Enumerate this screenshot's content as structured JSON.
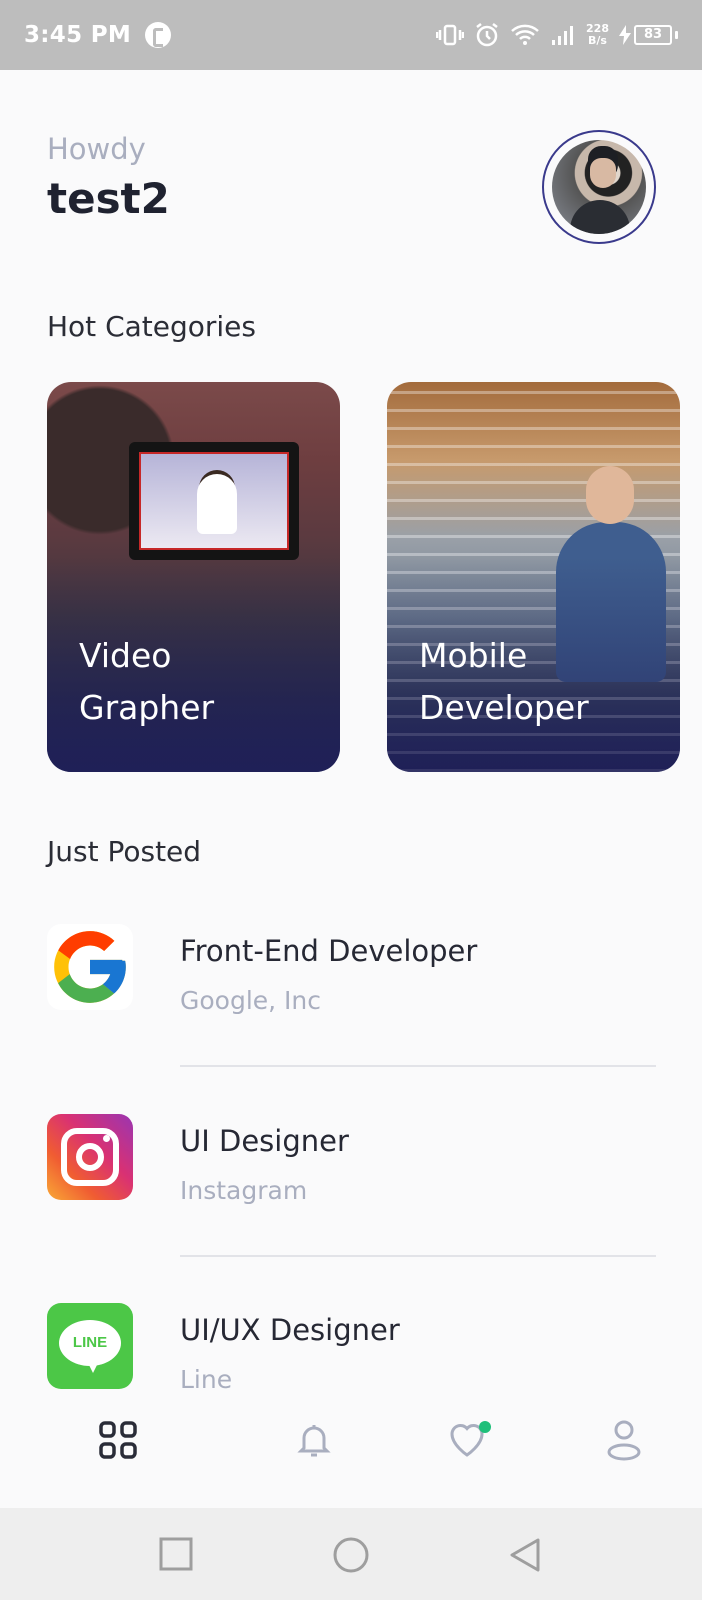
{
  "status_bar": {
    "time": "3:45 PM",
    "net_speed_value": "228",
    "net_speed_unit": "B/s",
    "battery": "83"
  },
  "header": {
    "greeting": "Howdy",
    "username": "test2"
  },
  "sections": {
    "hot_categories": "Hot Categories",
    "just_posted": "Just Posted"
  },
  "categories": [
    {
      "label": "Video\nGrapher"
    },
    {
      "label": "Mobile\nDeveloper"
    }
  ],
  "jobs": [
    {
      "title": "Front-End Developer",
      "company": "Google, Inc",
      "logo": "google-logo"
    },
    {
      "title": "UI Designer",
      "company": "Instagram",
      "logo": "instagram-logo"
    },
    {
      "title": "UI/UX Designer",
      "company": "Line",
      "logo": "line-logo"
    }
  ],
  "logo_text": {
    "line": "LINE"
  },
  "bottom_nav": [
    {
      "icon": "grid-icon",
      "active": true
    },
    {
      "icon": "bell-icon",
      "active": false
    },
    {
      "icon": "heart-icon",
      "active": false,
      "badge": true
    },
    {
      "icon": "user-icon",
      "active": false
    }
  ],
  "colors": {
    "accent": "#2d2f8f",
    "muted": "#a9aebf",
    "badge": "#1fbf7a"
  }
}
